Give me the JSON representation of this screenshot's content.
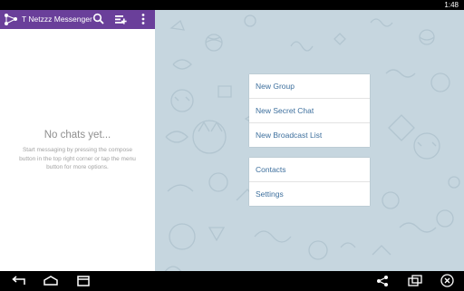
{
  "status_bar": {
    "time": "1:48"
  },
  "app": {
    "title": "T Netzzz Messenger"
  },
  "empty_state": {
    "title": "No chats yet...",
    "subtitle": "Start messaging by pressing the compose button in the top right corner or tap the menu button for more options."
  },
  "menu": {
    "group1": [
      "New Group",
      "New Secret Chat",
      "New Broadcast List"
    ],
    "group2": [
      "Contacts",
      "Settings"
    ]
  },
  "colors": {
    "action_bar": "#6a3f9a",
    "menu_text": "#3d6f9d",
    "background": "#c6d6df"
  },
  "icons": {
    "action_bar": [
      "search-icon",
      "compose-icon",
      "overflow-menu-icon"
    ],
    "nav_bar": [
      "back-icon",
      "home-icon",
      "recent-apps-icon",
      "share-icon",
      "screen-mirror-icon",
      "close-icon"
    ]
  }
}
